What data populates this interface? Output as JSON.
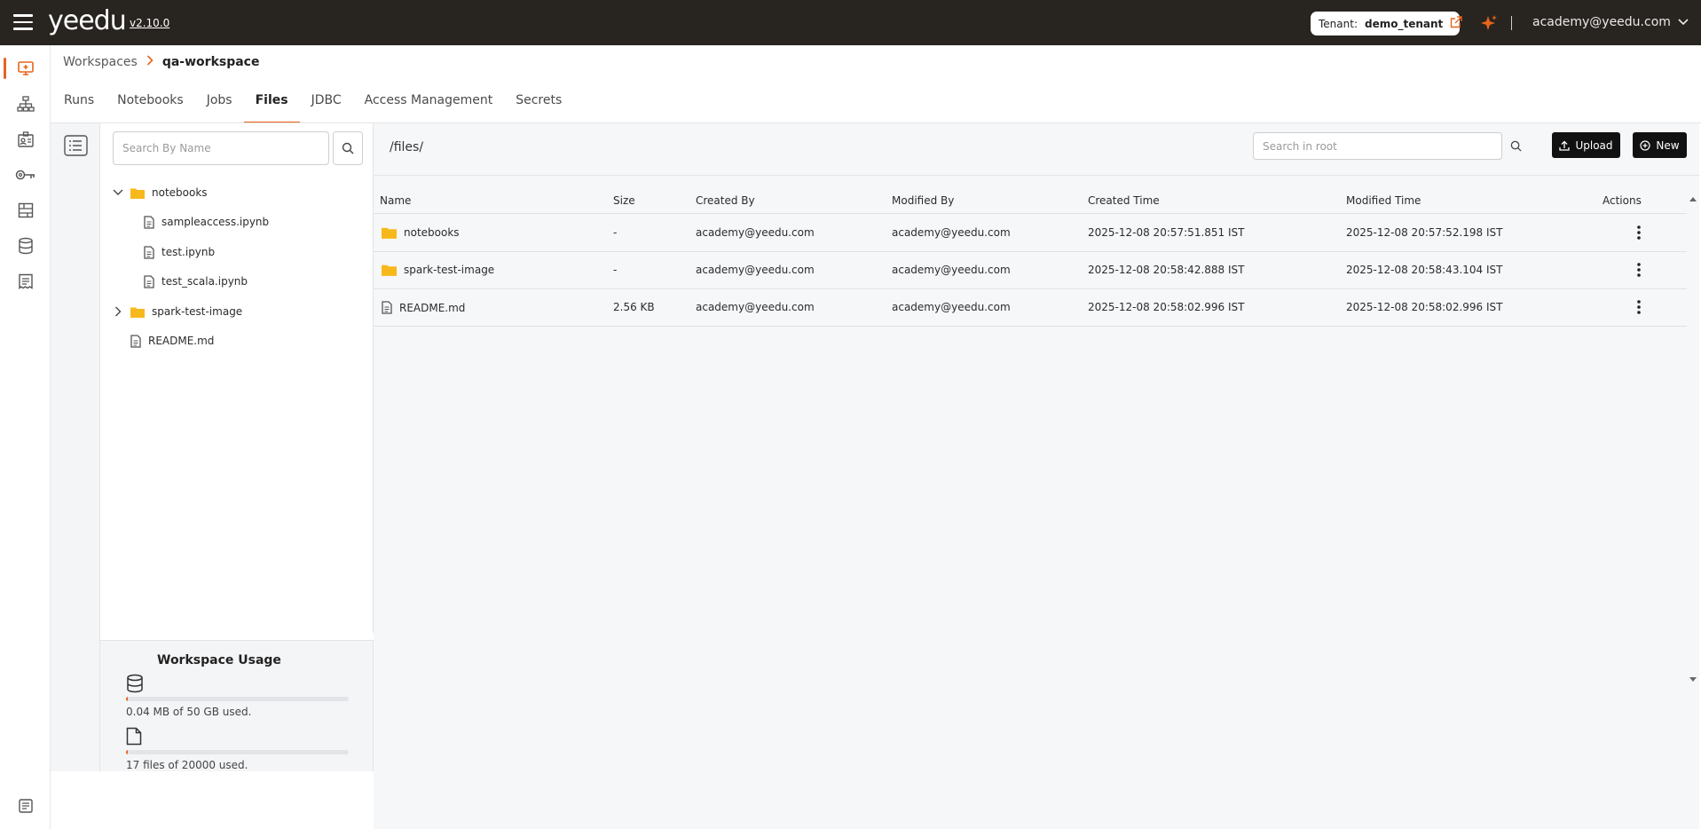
{
  "app": {
    "name": "yeedu",
    "version": "v2.10.0",
    "tenant_label": "Tenant:",
    "tenant_value": "demo_tenant",
    "user_email": "academy@yeedu.com",
    "accent_color": "#e8641b"
  },
  "rail": {
    "items": [
      {
        "name": "workspaces",
        "icon": "monitor-plus-icon",
        "active": true
      },
      {
        "name": "clusters",
        "icon": "hierarchy-icon",
        "active": false
      },
      {
        "name": "users",
        "icon": "id-card-icon",
        "active": false
      },
      {
        "name": "credentials",
        "icon": "key-icon",
        "active": false
      },
      {
        "name": "billing",
        "icon": "building-icon",
        "active": false
      },
      {
        "name": "metastore",
        "icon": "database-icon",
        "active": false
      },
      {
        "name": "docs",
        "icon": "receipt-icon",
        "active": false
      }
    ],
    "bottom_icon": "notes-icon"
  },
  "breadcrumb": {
    "root": "Workspaces",
    "current": "qa-workspace"
  },
  "tabs": [
    {
      "label": "Runs",
      "active": false
    },
    {
      "label": "Notebooks",
      "active": false
    },
    {
      "label": "Jobs",
      "active": false
    },
    {
      "label": "Files",
      "active": true
    },
    {
      "label": "JDBC",
      "active": false
    },
    {
      "label": "Access Management",
      "active": false
    },
    {
      "label": "Secrets",
      "active": false
    }
  ],
  "tree": {
    "search_placeholder": "Search By Name",
    "items": [
      {
        "label": "notebooks",
        "type": "folder",
        "expanded": true,
        "level": 0
      },
      {
        "label": "sampleaccess.ipynb",
        "type": "file",
        "level": 1
      },
      {
        "label": "test.ipynb",
        "type": "file",
        "level": 1
      },
      {
        "label": "test_scala.ipynb",
        "type": "file",
        "level": 1
      },
      {
        "label": "spark-test-image",
        "type": "folder",
        "expanded": false,
        "level": 0
      },
      {
        "label": "README.md",
        "type": "file",
        "level": 0
      }
    ]
  },
  "usage": {
    "title": "Workspace Usage",
    "storage_text": "0.04 MB of 50 GB used.",
    "storage_fraction": 8e-07,
    "files_text": "17 files of 20000 used.",
    "files_fraction": 0.00085
  },
  "files": {
    "path": "/files/",
    "search_placeholder": "Search in root",
    "upload_label": "Upload",
    "new_label": "New",
    "columns": [
      "Name",
      "Size",
      "Created By",
      "Modified By",
      "Created Time",
      "Modified Time",
      "Actions"
    ],
    "rows": [
      {
        "name": "notebooks",
        "type": "folder",
        "size": "-",
        "created_by": "academy@yeedu.com",
        "modified_by": "academy@yeedu.com",
        "created_time": "2025-12-08 20:57:51.851 IST",
        "modified_time": "2025-12-08 20:57:52.198 IST"
      },
      {
        "name": "spark-test-image",
        "type": "folder",
        "size": "-",
        "created_by": "academy@yeedu.com",
        "modified_by": "academy@yeedu.com",
        "created_time": "2025-12-08 20:58:42.888 IST",
        "modified_time": "2025-12-08 20:58:43.104 IST"
      },
      {
        "name": "README.md",
        "type": "file",
        "size": "2.56 KB",
        "created_by": "academy@yeedu.com",
        "modified_by": "academy@yeedu.com",
        "created_time": "2025-12-08 20:58:02.996 IST",
        "modified_time": "2025-12-08 20:58:02.996 IST"
      }
    ]
  }
}
